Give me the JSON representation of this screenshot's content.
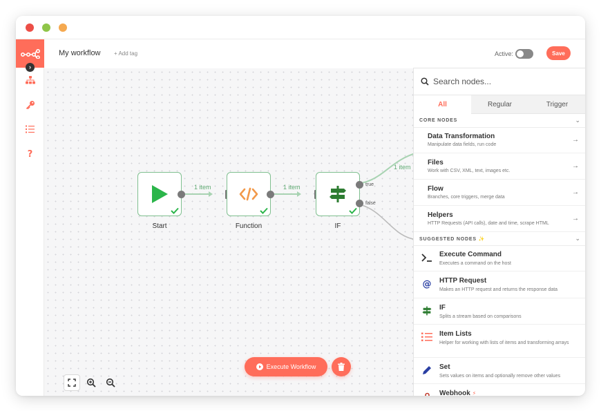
{
  "header": {
    "workflow_name": "My workflow",
    "add_tag": "+ Add tag",
    "active_label": "Active:",
    "save_label": "Save"
  },
  "canvas": {
    "nodes": [
      {
        "label": "Start"
      },
      {
        "label": "Function"
      },
      {
        "label": "IF"
      }
    ],
    "connections": {
      "start_to_function": "1 item",
      "function_to_if": "1 item",
      "if_true": "1 item"
    },
    "branches": {
      "true": "true",
      "false": "false"
    },
    "execute_label": "Execute Workflow"
  },
  "panel": {
    "search_placeholder": "Search nodes...",
    "tabs": [
      {
        "label": "All"
      },
      {
        "label": "Regular"
      },
      {
        "label": "Trigger"
      }
    ],
    "core_heading": "CORE NODES",
    "categories": [
      {
        "title": "Data Transformation",
        "desc": "Manipulate data fields, run code"
      },
      {
        "title": "Files",
        "desc": "Work with CSV, XML, text, images etc."
      },
      {
        "title": "Flow",
        "desc": "Branches, core triggers, merge data"
      },
      {
        "title": "Helpers",
        "desc": "HTTP Requests (API calls), date and time, scrape HTML"
      }
    ],
    "suggested_heading": "SUGGESTED NODES",
    "suggested": [
      {
        "title": "Execute Command",
        "desc": "Executes a command on the host"
      },
      {
        "title": "HTTP Request",
        "desc": "Makes an HTTP request and returns the response data"
      },
      {
        "title": "IF",
        "desc": "Splits a stream based on comparisons"
      },
      {
        "title": "Item Lists",
        "desc": "Helper for working with lists of items and transforming arrays"
      },
      {
        "title": "Set",
        "desc": "Sets values on items and optionally remove other values"
      },
      {
        "title": "Webhook",
        "desc": ""
      }
    ]
  },
  "colors": {
    "brand": "#ff6d5a",
    "success": "#7fbf8f",
    "start_icon": "#2bb54a",
    "function_icon": "#f2994a",
    "if_icon": "#2e7d32"
  },
  "icons": {
    "logo": "n8n-logo-icon",
    "sidebar": [
      "workflows-icon",
      "credentials-key-icon",
      "executions-list-icon",
      "help-icon"
    ]
  }
}
